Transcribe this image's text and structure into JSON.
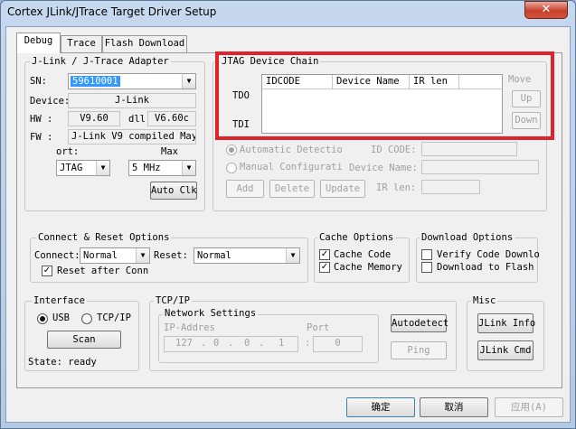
{
  "window": {
    "title": "Cortex JLink/JTrace Target Driver Setup",
    "close_glyph": "✕"
  },
  "tabs": [
    {
      "label": "Debug",
      "active": true
    },
    {
      "label": "Trace",
      "active": false
    },
    {
      "label": "Flash Download",
      "active": false
    }
  ],
  "adapter": {
    "title": "J-Link / J-Trace Adapter",
    "sn_label": "SN:",
    "sn_value": "59610001",
    "device_label": "Device:",
    "device_value": "J-Link",
    "hw_label": "HW :",
    "hw_value": "V9.60",
    "dll_label": "dll",
    "dll_value": "V6.60c",
    "fw_label": "FW :",
    "fw_value": "J-Link V9 compiled May",
    "port_label": "ort:",
    "port_value": "JTAG",
    "max_label": "Max",
    "max_value": "5 MHz",
    "auto_clk_label": "Auto Clk"
  },
  "jtag": {
    "title": "JTAG Device Chain",
    "tdo_label": "TDO",
    "tdi_label": "TDI",
    "columns": [
      "IDCODE",
      "Device Name",
      "IR len"
    ],
    "move_label": "Move",
    "up_label": "Up",
    "down_label": "Down",
    "auto_detect_label": "Automatic Detectio",
    "manual_config_label": "Manual Configurati",
    "id_code_label": "ID CODE:",
    "device_name_label": "Device Name:",
    "ir_len_label": "IR len:",
    "add_label": "Add",
    "delete_label": "Delete",
    "update_label": "Update"
  },
  "connect": {
    "title": "Connect & Reset Options",
    "connect_label": "Connect:",
    "connect_value": "Normal",
    "reset_label": "Reset:",
    "reset_value": "Normal",
    "reset_after_label": "Reset after Conn",
    "reset_after_checked": true
  },
  "cache": {
    "title": "Cache Options",
    "code_label": "Cache Code",
    "code_checked": true,
    "memory_label": "Cache Memory",
    "memory_checked": true
  },
  "download": {
    "title": "Download Options",
    "verify_label": "Verify Code Downlo",
    "verify_checked": false,
    "flash_label": "Download to Flash",
    "flash_checked": false
  },
  "interface": {
    "title": "Interface",
    "usb_label": "USB",
    "tcpip_label": "TCP/IP",
    "scan_label": "Scan",
    "state_label": "State: ready"
  },
  "tcpip": {
    "title": "TCP/IP",
    "network_title": "Network Settings",
    "ip_label": "IP-Addres",
    "ip_octets": [
      "127",
      "0",
      "0",
      "1"
    ],
    "port_label": "Port",
    "port_value": "0",
    "autodetect_label": "Autodetect",
    "ping_label": "Ping"
  },
  "misc": {
    "title": "Misc",
    "jlink_info_label": "JLink Info",
    "jlink_cmd_label": "JLink Cmd"
  },
  "footer": {
    "ok_label": "确定",
    "cancel_label": "取消",
    "apply_label": "应用(A)"
  },
  "colors": {
    "highlight": "#e0232b",
    "selection": "#3399ff"
  }
}
